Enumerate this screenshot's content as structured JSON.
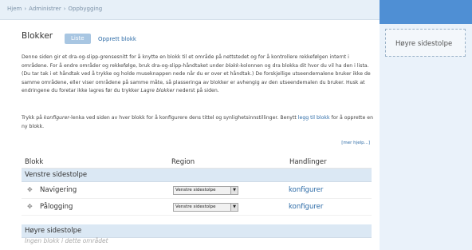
{
  "breadcrumb": {
    "items": [
      "Hjem",
      "Administrer",
      "Oppbygging"
    ],
    "separator": "›"
  },
  "page": {
    "title": "Blokker",
    "tabs": {
      "list": "Liste",
      "create": "Opprett blokk"
    }
  },
  "help": {
    "para1": {
      "a": "Denne siden gir et dra-og-slipp-grensesnitt for å knytte en blokk til et område på nettstedet og for å kontrollere rekkefølgen internt i områdene. For å endre områder og rekkefølge, bruk dra-og-slipp-håndtaket under ",
      "em": "blokk",
      "b": "-kolonnen og dra blokka dit hvor du vil ha den i lista. (Du tar tak i et håndtak ved å trykke og holde museknappen nede når du er over et håndtak.) De forskjellige utseendemalene bruker ikke de samme områdene, eller viser områdene på samme måte, så plasseringa av blokker er avhengig av den utseendemalen du bruker. Husk at endringene du foretar ikke lagres før du trykker ",
      "em2": "Lagre blokker",
      "c": " nederst på siden."
    },
    "para2": {
      "a": "Trykk på ",
      "em": "konfigurer",
      "b": "-lenka ved siden av hver blokk for å konfigurere dens tittel og synlighetsinnstillinger. Benytt ",
      "link": "legg til blokk",
      "c": " for å opprette en ny blokk."
    },
    "more_help": "[mer hjelp...]"
  },
  "table": {
    "headers": {
      "block": "Blokk",
      "region": "Region",
      "actions": "Handlinger"
    },
    "regions": [
      {
        "name": "Venstre sidestolpe",
        "blocks": [
          {
            "name": "Navigering",
            "region": "Venstre sidestolpe",
            "action": "konfigurer"
          },
          {
            "name": "Pålogging",
            "region": "Venstre sidestolpe",
            "action": "konfigurer"
          }
        ]
      },
      {
        "name": "Høyre sidestolpe",
        "empty_text": "Ingen blokk i dette området"
      }
    ]
  },
  "sidebar_right": {
    "region_label": "Høyre sidestolpe"
  },
  "colors": {
    "accent": "#4f8fd4",
    "link": "#2b6aa6",
    "tab_active": "#a8c6e2",
    "region_row": "#dbe8f4"
  },
  "icons": {
    "drag_handle": "drag-handle-icon",
    "select_arrow": "chevron-down-icon"
  }
}
